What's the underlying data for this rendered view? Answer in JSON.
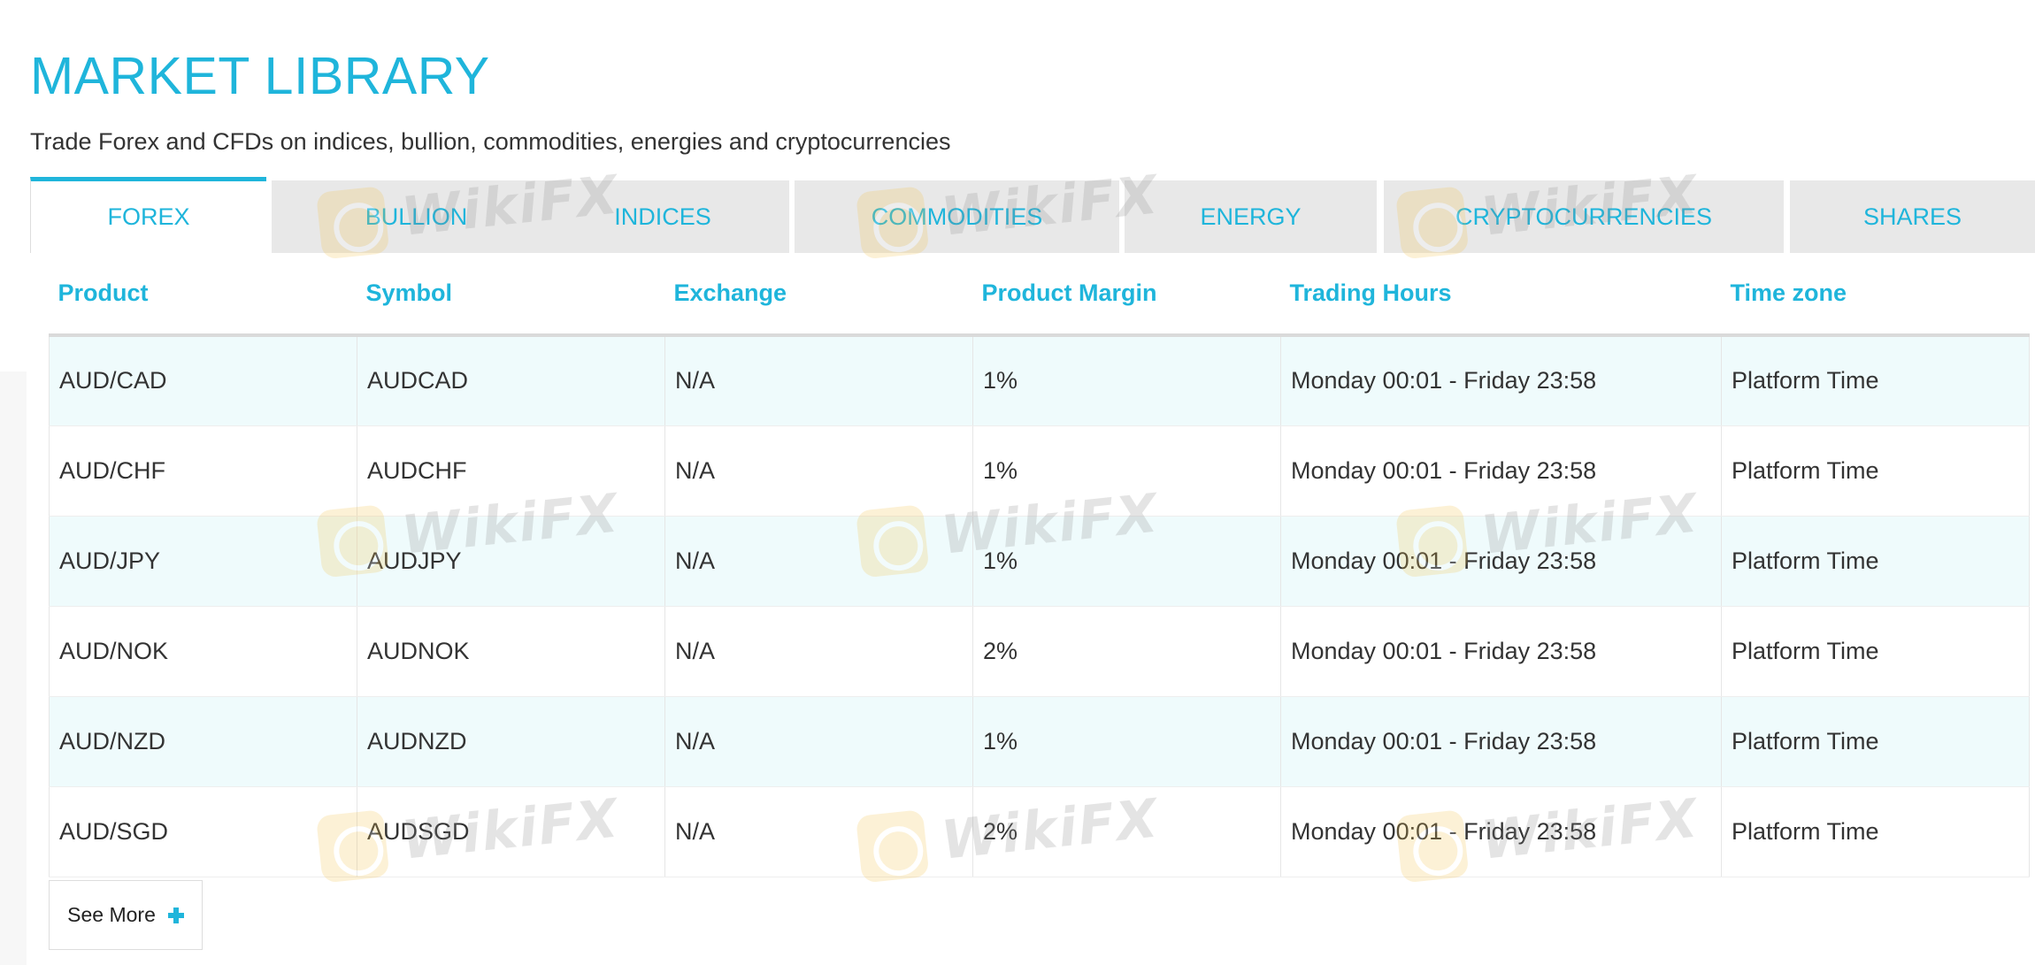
{
  "page": {
    "title": "MARKET LIBRARY",
    "subtitle": "Trade Forex and CFDs on indices, bullion, commodities, energies and cryptocurrencies"
  },
  "tabs": [
    {
      "label": "FOREX",
      "active": true
    },
    {
      "label": "BULLION",
      "active": false
    },
    {
      "label": "INDICES",
      "active": false
    },
    {
      "label": "COMMODITIES",
      "active": false
    },
    {
      "label": "ENERGY",
      "active": false
    },
    {
      "label": "CRYPTOCURRENCIES",
      "active": false
    },
    {
      "label": "SHARES",
      "active": false
    }
  ],
  "table": {
    "columns": [
      "Product",
      "Symbol",
      "Exchange",
      "Product Margin",
      "Trading Hours",
      "Time zone"
    ],
    "rows": [
      [
        "AUD/CAD",
        "AUDCAD",
        "N/A",
        "1%",
        "Monday 00:01 - Friday 23:58",
        "Platform Time"
      ],
      [
        "AUD/CHF",
        "AUDCHF",
        "N/A",
        "1%",
        "Monday 00:01 - Friday 23:58",
        "Platform Time"
      ],
      [
        "AUD/JPY",
        "AUDJPY",
        "N/A",
        "1%",
        "Monday 00:01 - Friday 23:58",
        "Platform Time"
      ],
      [
        "AUD/NOK",
        "AUDNOK",
        "N/A",
        "2%",
        "Monday 00:01 - Friday 23:58",
        "Platform Time"
      ],
      [
        "AUD/NZD",
        "AUDNZD",
        "N/A",
        "1%",
        "Monday 00:01 - Friday 23:58",
        "Platform Time"
      ],
      [
        "AUD/SGD",
        "AUDSGD",
        "N/A",
        "2%",
        "Monday 00:01 - Friday 23:58",
        "Platform Time"
      ]
    ]
  },
  "see_more": {
    "label": "See More",
    "icon": "plus-icon"
  },
  "watermark": {
    "text": "WikiFX"
  },
  "colors": {
    "accent": "#1fb5db",
    "row_alt": "#effbfc",
    "tab_bg": "#e8e8e8"
  }
}
